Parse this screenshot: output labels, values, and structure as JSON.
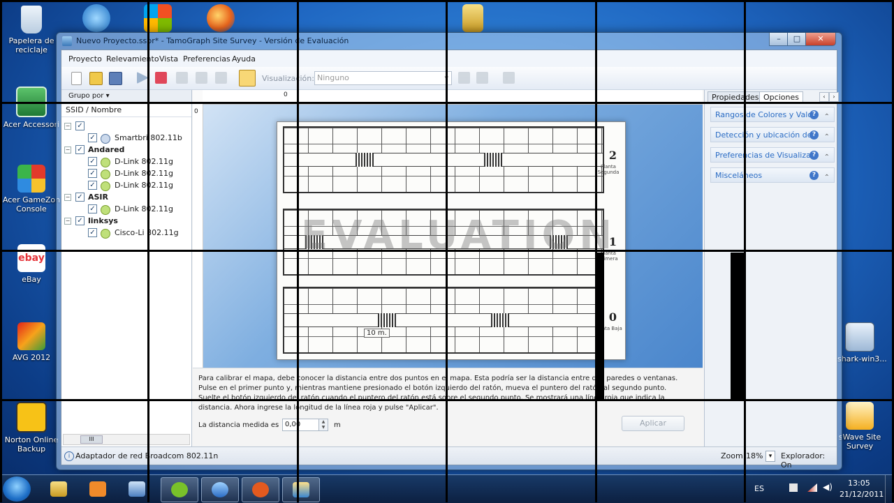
{
  "desktop": {
    "icons": [
      {
        "label": "Papelera de reciclaje",
        "icon": "recycle-bin-icon"
      },
      {
        "label": "Acer Accessori",
        "icon": "acer-icon"
      },
      {
        "label": "Acer GameZon Console",
        "icon": "gamezone-cube-icon"
      },
      {
        "label": "eBay",
        "icon": "ebay-icon"
      },
      {
        "label": "AVG 2012",
        "icon": "avg-icon"
      },
      {
        "label": "Norton Online Backup",
        "icon": "norton-icon"
      },
      {
        "label": "eshark-win3...",
        "icon": "wireshark-icon"
      },
      {
        "label": "sWave Site Survey",
        "icon": "tamosoft-wave-icon"
      }
    ],
    "ebay_glyph": "ebay"
  },
  "window": {
    "title": "Nuevo Proyecto.sspr* - TamoGraph Site Survey - Versión de Evaluación",
    "controls": {
      "minimize": "–",
      "maximize": "□",
      "close": "✕"
    }
  },
  "menu": [
    "Proyecto",
    "Relevamiento",
    "Vista",
    "Preferencias",
    "Ayuda"
  ],
  "toolbar": {
    "viz_label": "Visualización:",
    "viz_value": "Ninguno"
  },
  "left_pane": {
    "group_by": "Grupo por ▾",
    "column": "SSID / Nombre",
    "tree": [
      {
        "type": "group",
        "label": ""
      },
      {
        "type": "ap",
        "label": "Smartbri 802.11b",
        "icon": "blue"
      },
      {
        "type": "group",
        "label": "Andared"
      },
      {
        "type": "ap",
        "label": "D-Link 802.11g",
        "icon": "green"
      },
      {
        "type": "ap",
        "label": "D-Link 802.11g",
        "icon": "green"
      },
      {
        "type": "ap",
        "label": "D-Link 802.11g",
        "icon": "green"
      },
      {
        "type": "group",
        "label": "ASIR"
      },
      {
        "type": "ap",
        "label": "D-Link 802.11g",
        "icon": "green"
      },
      {
        "type": "group",
        "label": "linksys"
      },
      {
        "type": "ap",
        "label": "Cisco-Li 802.11g",
        "icon": "green"
      }
    ],
    "scroll_thumb": "III"
  },
  "map": {
    "ruler_top_zero": "0",
    "ruler_left_zero": "0",
    "watermark": "EVALUATION",
    "scale_label": "10 m.",
    "floors": [
      {
        "number": "2",
        "label": "Planta Segunda"
      },
      {
        "number": "1",
        "label": "Planta Primera"
      },
      {
        "number": "0",
        "label": "Planta Baja"
      }
    ]
  },
  "calibration": {
    "text": "Para calibrar el mapa, debe conocer la distancia entre dos puntos en el mapa. Esta podría ser la distancia entre dos paredes o ventanas. Pulse en el primer punto y, mientras mantiene presionado el botón izquierdo del ratón, mueva el puntero del ratón al segundo punto. Suelte el botón izquierdo del ratón cuando el puntero del ratón está sobre el segundo punto. Se mostrará una línea roja que indica la distancia. Ahora ingrese la longitud de la línea roja y pulse \"Aplicar\".",
    "distance_label": "La distancia medida es",
    "distance_value": "0,00",
    "unit": "m",
    "apply_label": "Aplicar"
  },
  "right_pane": {
    "tabs": [
      "Propiedades",
      "Opciones"
    ],
    "selected_tab": "Opciones",
    "sections": [
      "Rangos de Colores y Valo",
      "Detección y ubicación de",
      "Preferencias de Visualizac",
      "Misceláneos"
    ]
  },
  "status": {
    "adapter": "Adaptador de red Broadcom 802.11n",
    "zoom_label": "Zoom:",
    "zoom_value": "18%",
    "explorer": "Explorador: On"
  },
  "taskbar": {
    "lang": "ES",
    "time": "13:05",
    "date": "21/12/2011"
  },
  "colors": {
    "accent": "#2b6cc4",
    "desktop": "#1f67c2"
  }
}
